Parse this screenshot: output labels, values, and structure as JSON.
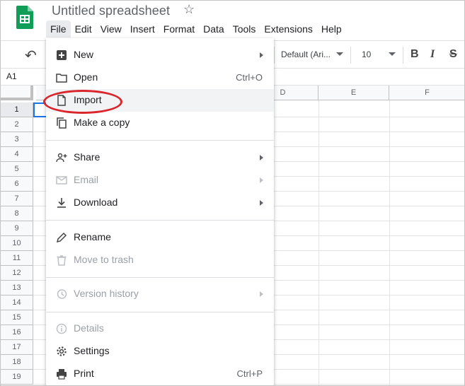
{
  "doc": {
    "title": "Untitled spreadsheet"
  },
  "menubar": [
    "File",
    "Edit",
    "View",
    "Insert",
    "Format",
    "Data",
    "Tools",
    "Extensions",
    "Help"
  ],
  "toolbar": {
    "font": "Default (Ari...",
    "font_size": "10",
    "bold": "B",
    "italic": "I",
    "strike": "S"
  },
  "namebox": "A1",
  "columns": [
    "D",
    "E",
    "F"
  ],
  "rows": [
    "1",
    "2",
    "3",
    "4",
    "5",
    "6",
    "7",
    "8",
    "9",
    "10",
    "11",
    "12",
    "13",
    "14",
    "15",
    "16",
    "17",
    "18",
    "19"
  ],
  "file_menu": {
    "new": "New",
    "open": "Open",
    "open_sc": "Ctrl+O",
    "import": "Import",
    "copy": "Make a copy",
    "share": "Share",
    "email": "Email",
    "download": "Download",
    "rename": "Rename",
    "trash": "Move to trash",
    "version": "Version history",
    "details": "Details",
    "settings": "Settings",
    "print": "Print",
    "print_sc": "Ctrl+P"
  },
  "colors": {
    "highlight": "#d9262c",
    "sheets_green": "#0f9d58",
    "selection_blue": "#1a73e8"
  }
}
